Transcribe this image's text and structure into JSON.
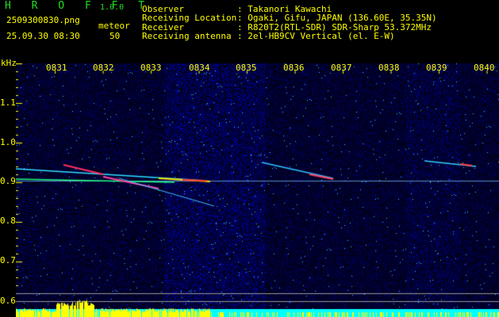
{
  "header": {
    "app_name": "HROFFT",
    "version": "1.0.0",
    "filename": "2509300830.png",
    "datetime": "25.09.30 08:30",
    "meteor_label": "meteor",
    "meteor_count": "50"
  },
  "info": [
    {
      "key": "Observer",
      "value": ": Takanori Kawachi"
    },
    {
      "key": "Receiving Location",
      "value": ": Ogaki, Gifu, JAPAN (136.60E, 35.35N)"
    },
    {
      "key": "Receiver",
      "value": ": R820T2(RTL-SDR) SDR-Sharp 53.372MHz"
    },
    {
      "key": "Receiving antenna",
      "value": ": 2el-HB9CV Vertical (el. E-W)"
    }
  ],
  "axis": {
    "y_unit": "kHz",
    "y_ticks": [
      "1.1",
      "1.0",
      "0.9",
      "0.8",
      "0.7",
      "0.6"
    ],
    "x_ticks": [
      "0831",
      "0832",
      "0833",
      "0834",
      "0835",
      "0836",
      "0837",
      "0838",
      "0839",
      "0840"
    ]
  },
  "colors": {
    "text": "#ffff00",
    "logo": "#22dd22",
    "bars": "#ffff00",
    "baseline": "#00ffff"
  }
}
